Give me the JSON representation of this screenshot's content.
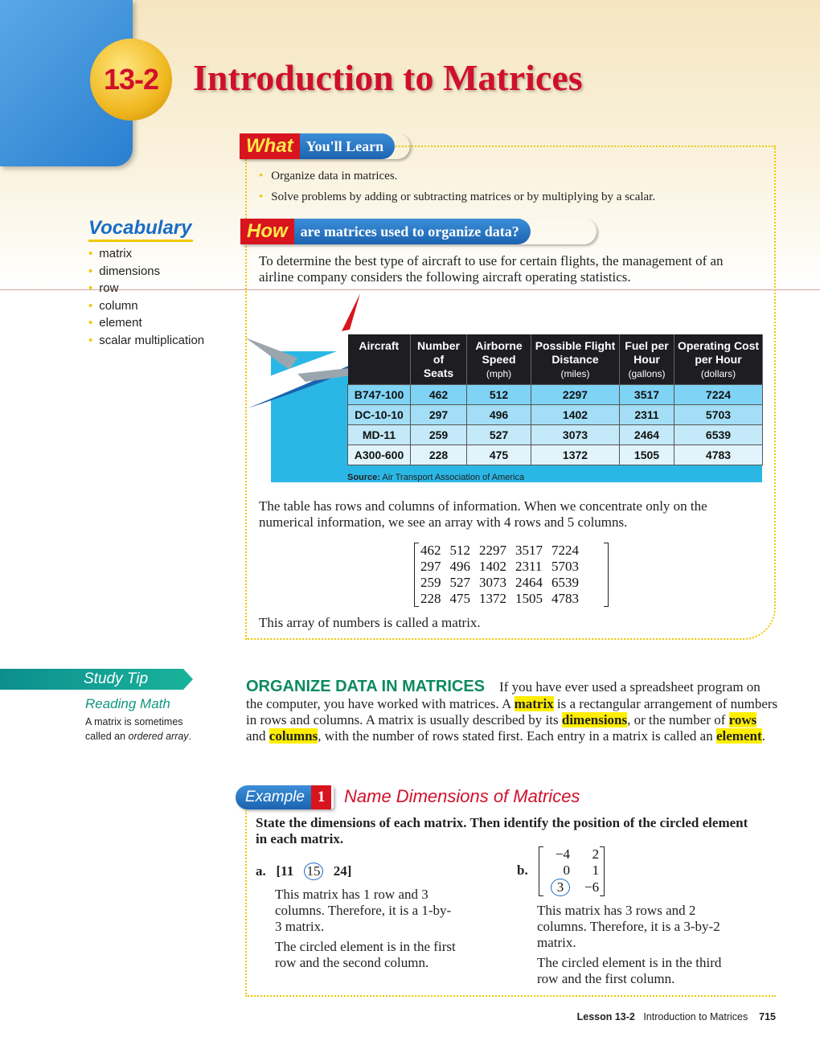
{
  "header": {
    "lesson_number": "13-2",
    "title": "Introduction to Matrices"
  },
  "what_learn": {
    "tag": "What",
    "label": "You'll Learn",
    "items": [
      "Organize data in matrices.",
      "Solve problems by adding or subtracting matrices or by multiplying by a scalar."
    ]
  },
  "how": {
    "tag": "How",
    "label": "are matrices used to organize data?",
    "text": "To determine the best type of aircraft to use for certain flights, the management of an airline company considers the following aircraft operating statistics."
  },
  "vocabulary": {
    "title": "Vocabulary",
    "items": [
      "matrix",
      "dimensions",
      "row",
      "column",
      "element",
      "scalar multiplication"
    ]
  },
  "table": {
    "headers": [
      [
        "Aircraft",
        "",
        ""
      ],
      [
        "Number",
        "of",
        "Seats"
      ],
      [
        "Airborne",
        "Speed",
        "(mph)"
      ],
      [
        "Possible Flight",
        "Distance",
        "(miles)"
      ],
      [
        "Fuel per",
        "Hour",
        "(gallons)"
      ],
      [
        "Operating Cost",
        "per Hour",
        "(dollars)"
      ]
    ],
    "rows": [
      [
        "B747-100",
        "462",
        "512",
        "2297",
        "3517",
        "7224"
      ],
      [
        "DC-10-10",
        "297",
        "496",
        "1402",
        "2311",
        "5703"
      ],
      [
        "MD-11",
        "259",
        "527",
        "3073",
        "2464",
        "6539"
      ],
      [
        "A300-600",
        "228",
        "475",
        "1372",
        "1505",
        "4783"
      ]
    ],
    "source_label": "Source:",
    "source": "Air Transport Association of America"
  },
  "para1": "The table has rows and columns of information. When we concentrate only on the numerical information, we see an array with 4 rows and 5 columns.",
  "matrix": [
    [
      "462",
      "512",
      "2297",
      "3517",
      "7224"
    ],
    [
      "297",
      "496",
      "1402",
      "2311",
      "5703"
    ],
    [
      "259",
      "527",
      "3073",
      "2464",
      "6539"
    ],
    [
      "228",
      "475",
      "1372",
      "1505",
      "4783"
    ]
  ],
  "para2": "This array of numbers is called a matrix.",
  "study_tip": {
    "label": "Study Tip",
    "heading": "Reading Math",
    "text1": "A matrix is sometimes called an ",
    "text2": "ordered array",
    "text3": "."
  },
  "organize": {
    "heading": "ORGANIZE DATA IN MATRICES",
    "t1": "If you have ever used a spreadsheet program on the computer, you have worked with matrices. A ",
    "k1": "matrix",
    "t2": " is a rectangular arrangement of numbers in rows and columns. A matrix is usually described by its ",
    "k2": "dimensions",
    "t3": ", or the number of ",
    "k3": "rows",
    "t4": " and ",
    "k4": "columns",
    "t5": ", with the number of rows stated first. Each entry in a matrix is called an ",
    "k5": "element",
    "t6": "."
  },
  "example": {
    "tag": "Example",
    "number": "1",
    "title": "Name Dimensions of Matrices",
    "prompt": "State the dimensions of each matrix. Then identify the position of the circled element in each matrix.",
    "a": {
      "label": "a.",
      "m1": "[11",
      "m2": "15",
      "m3": "24]",
      "text1": "This matrix has 1 row and 3 columns. Therefore, it is a 1-by-3 matrix.",
      "text2": "The circled element is in the first row and the second column."
    },
    "b": {
      "label": "b.",
      "matrix": [
        [
          "−4",
          "2"
        ],
        [
          "0",
          "1"
        ],
        [
          "3",
          "−6"
        ]
      ],
      "text1": "This matrix has 3 rows and 2 columns. Therefore, it is a 3-by-2 matrix.",
      "text2": "The circled element is in the third row and the first column."
    }
  },
  "footer": {
    "lesson": "Lesson 13-2",
    "title": "Introduction to Matrices",
    "page": "715"
  },
  "colors": {
    "title_red": "#d0102a",
    "banner_blue": "#1b63b0",
    "highlight": "#ffee00",
    "heading_green": "#0c8a5e",
    "table_bg": "#2bb7e6"
  }
}
